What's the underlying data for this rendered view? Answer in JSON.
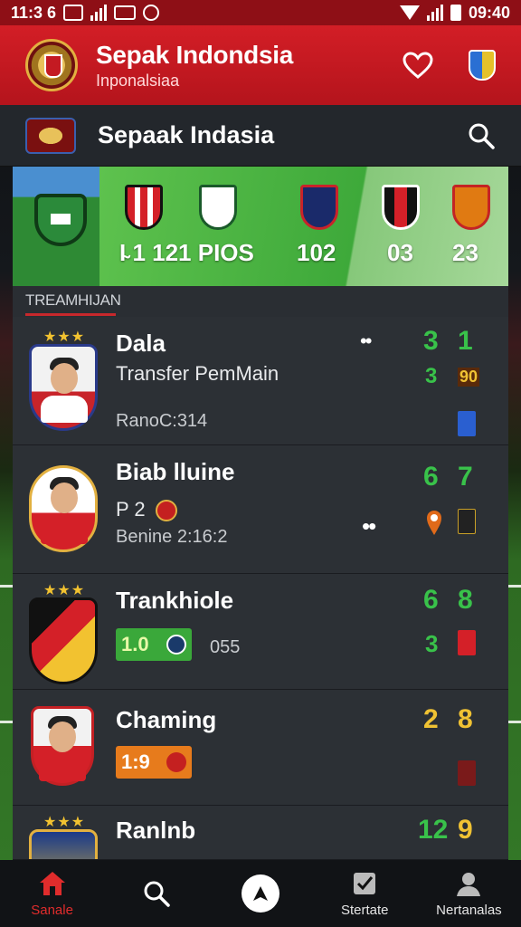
{
  "status_bar": {
    "time_left": "11:3 6",
    "time_right": "09:40"
  },
  "app_bar": {
    "title": "Sepak Indondsia",
    "subtitle": "Inponalsiaa"
  },
  "sub_header": {
    "title": "Sepaak Indasia"
  },
  "banner": {
    "stat_left": "I̴ 1 121 PIOS",
    "stat_mid": "102",
    "stat_right1": "03",
    "stat_right2": "23"
  },
  "section": {
    "label": "TREAMHIJAN"
  },
  "rows": [
    {
      "name": "Dala",
      "sub": "Transfer PemMain",
      "meta": "RanoC:314",
      "n1": "3",
      "n2": "1",
      "n3": "3",
      "n4": "90"
    },
    {
      "name": "Biab lluine",
      "sub": "P 2",
      "meta": "Benine 2:16:2",
      "n1": "6",
      "n2": "7"
    },
    {
      "name": "Trankhiole",
      "pill": "1.0",
      "meta": "055",
      "n1": "6",
      "n2": "8",
      "n3": "3"
    },
    {
      "name": "Chaming",
      "pill": "1:9",
      "n1": "2",
      "n2": "8"
    },
    {
      "name": "Ranlnb",
      "n1": "12",
      "n2": "9"
    }
  ],
  "bottom_nav": [
    {
      "label": "Sanale",
      "icon": "home-icon"
    },
    {
      "label": "",
      "icon": "search-icon"
    },
    {
      "label": "",
      "icon": "compass-icon"
    },
    {
      "label": "Stertate",
      "icon": "clipboard-icon"
    },
    {
      "label": "Nertanalas",
      "icon": "profile-icon"
    }
  ],
  "colors": {
    "brand_red": "#d31e26",
    "accent_green": "#39c24a",
    "accent_yellow": "#f0c233"
  }
}
